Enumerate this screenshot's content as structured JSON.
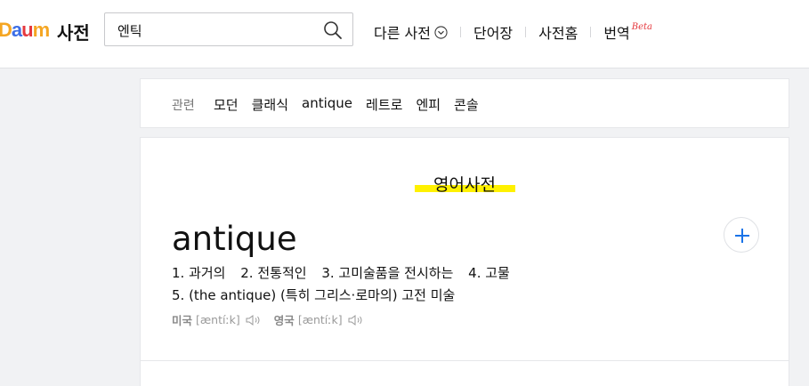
{
  "header": {
    "logo_letters": [
      "D",
      "a",
      "u",
      "m"
    ],
    "logo_colors": [
      "#f5a623",
      "#3c6ee6",
      "#e5383e",
      "#f5a623"
    ],
    "service_name": "사전",
    "search": {
      "value": "엔틱",
      "placeholder": ""
    },
    "nav": [
      {
        "label": "다른 사전",
        "icon": "chevron-down-circle-icon"
      },
      {
        "label": "단어장"
      },
      {
        "label": "사전홈"
      },
      {
        "label": "번역",
        "badge": "Beta"
      }
    ]
  },
  "related": {
    "label": "관련",
    "items": [
      "모던",
      "클래식",
      "antique",
      "레트로",
      "엔피",
      "콘솔"
    ]
  },
  "entry": {
    "section_title": "영어사전",
    "headword": "antique",
    "meanings_line1": [
      "1. 과거의",
      "2. 전통적인",
      "3. 고미술품을 전시하는",
      "4. 고물"
    ],
    "meanings_line2": "5. (the antique) (특히 그리스·로마의) 고전 미술",
    "pronunciations": [
      {
        "label": "미국",
        "ipa": "[æntíːk]"
      },
      {
        "label": "영국",
        "ipa": "[æntíːk]"
      }
    ],
    "highlight_color": "#fff100"
  }
}
